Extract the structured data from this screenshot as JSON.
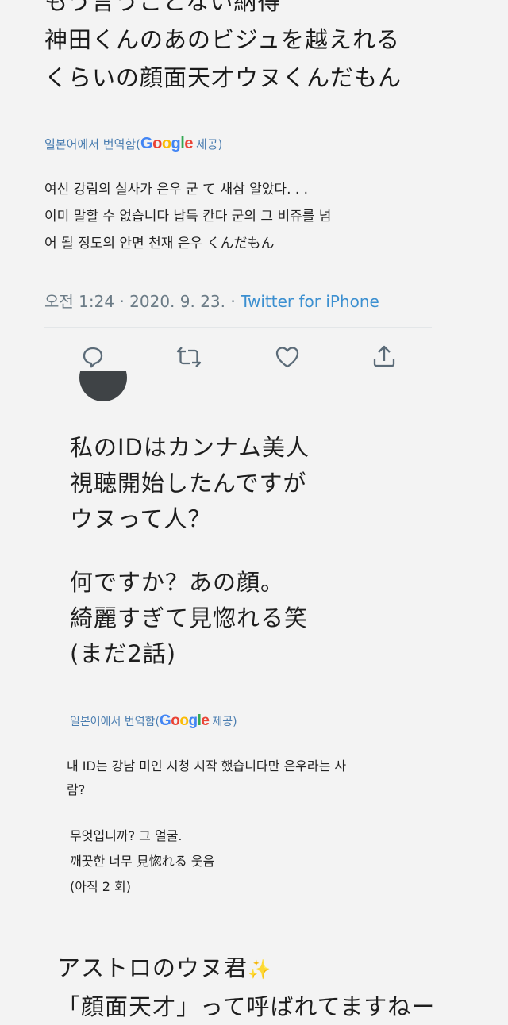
{
  "tweet": {
    "text_lines": [
      "もう言うことない納得",
      "神田くんのあのビジュを越えれる",
      "くらいの顔面天才ウヌくんだもん"
    ],
    "translate_prefix": "일본어에서 번역함(",
    "translate_suffix": "제공)",
    "translation_lines": [
      "여신 강림의 실사가 은우 군 て 새삼 알았다. . .",
      " 이미 말할 수 없습니다 납득 칸다 군의 그 비쥬를 넘",
      "어 될 정도의 안면 천재 은우 くんだもん"
    ],
    "timestamp": "오전 1:24 · 2020. 9. 23. · ",
    "source": "Twitter for iPhone",
    "actions": [
      "reply",
      "retweet",
      "like",
      "share"
    ]
  },
  "post2": {
    "lines_a": [
      "私のIDはカンナム美人",
      "視聴開始したんですが",
      "ウヌって人？"
    ],
    "lines_b": [
      "何ですか？あの顔。",
      "綺麗すぎて見惚れる笑",
      "(まだ2話)"
    ],
    "translate_prefix": "일본어에서 번역함(",
    "translate_suffix": "제공)",
    "translation_lines": [
      "내 ID는 강남 미인 시청 시작 했습니다만 은우라는 사",
      "람?"
    ],
    "translation_lines_b": [
      "무엇입니까? 그 얼굴.",
      "깨끗한 너무 見惚れる 웃음",
      "(아직 2 회)"
    ]
  },
  "post3": {
    "line1": "アストロのウヌ君",
    "line2": "「顔面天才」って呼ばれてますねー"
  },
  "google_letters": [
    "G",
    "o",
    "o",
    "g",
    "l",
    "e"
  ],
  "colors": {
    "link": "#3b8fd0",
    "meta": "#6b7b86",
    "translate": "#4a7db0"
  }
}
